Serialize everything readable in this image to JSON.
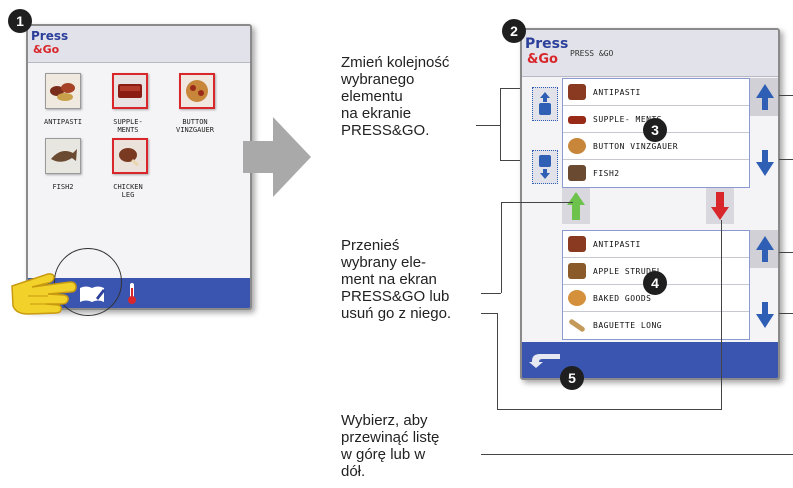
{
  "screen1": {
    "logo_line1": "Press",
    "logo_line2": "&Go",
    "items": [
      {
        "label_line1": "ANTIPASTI",
        "label_line2": "",
        "selected": false,
        "icon": "antipasti-icon"
      },
      {
        "label_line1": "SUPPLE-",
        "label_line2": "MENTS",
        "selected": true,
        "icon": "supplements-icon"
      },
      {
        "label_line1": "BUTTON",
        "label_line2": "VINZGAUER",
        "selected": true,
        "icon": "button-vinzgauer-icon"
      },
      {
        "label_line1": "FISH2",
        "label_line2": "",
        "selected": false,
        "icon": "fish-icon"
      },
      {
        "label_line1": "CHICKEN",
        "label_line2": "LEG",
        "selected": true,
        "icon": "chicken-leg-icon"
      }
    ],
    "bottom_icons": [
      "edit-book-icon",
      "thermometer-icon"
    ]
  },
  "screen2": {
    "logo_line1": "Press",
    "logo_line2": "&Go",
    "header_title": "PRESS &GO",
    "top_list": [
      "ANTIPASTI",
      "SUPPLE- MENTS",
      "BUTTON VINZGAUER",
      "FISH2"
    ],
    "bottom_list": [
      "ANTIPASTI",
      "APPLE STRUDEL",
      "BAKED GOODS",
      "BAGUETTE LONG"
    ],
    "back_icon": "back-arrow-icon"
  },
  "callouts": [
    "1",
    "2",
    "3",
    "4",
    "5"
  ],
  "instructions": {
    "reorder": [
      "Zmień kolejność",
      "wybranego",
      "elementu",
      "na ekranie",
      "PRESS&GO."
    ],
    "move": [
      "Przenieś",
      "wybrany ele-",
      "ment na ekran",
      "PRESS&GO lub",
      "usuń go z niego."
    ],
    "scroll": [
      "Wybierz, aby",
      "przewinąć listę",
      "w górę lub w",
      "dół."
    ]
  },
  "colors": {
    "accent_blue": "#3a55b0",
    "selection_red": "#d8262b",
    "arrow_green": "#6cc24a",
    "arrow_blue": "#2f5fb5",
    "logo_blue": "#2c3f9a"
  }
}
